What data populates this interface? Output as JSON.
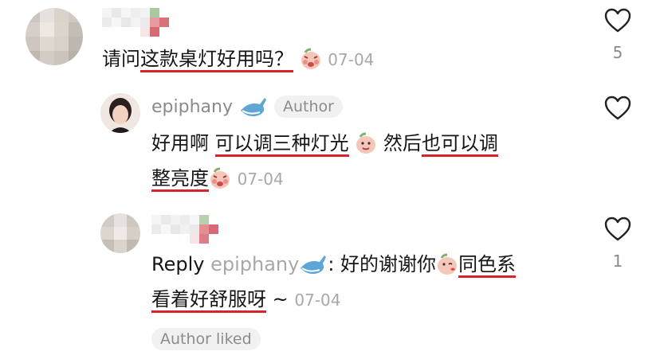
{
  "comments": [
    {
      "text_parts": [
        "请问",
        "这款桌灯好用吗？"
      ],
      "date": "07-04",
      "like_count": "5"
    }
  ],
  "replies": [
    {
      "username": "epiphany",
      "badge": "Author",
      "line1_parts": [
        "好用啊 ",
        "可以调三种灯光",
        " 然后",
        "也可以调"
      ],
      "line2_parts": [
        "整亮度"
      ],
      "date": "07-04"
    },
    {
      "prefix": "Reply",
      "mention": "epiphany",
      "line1_parts": [
        ": 好的谢谢你",
        "同色系"
      ],
      "line2_parts": [
        "看着好舒服呀",
        " ~"
      ],
      "date": "07-04",
      "like_count": "1",
      "author_liked": "Author liked"
    }
  ],
  "colors": {
    "underline": "#d8232a",
    "muted": "#a8a8a8"
  },
  "icons": {
    "like": "heart-outline-icon",
    "verified": "whale-icon",
    "emoji": "peach-emoji-icon"
  }
}
